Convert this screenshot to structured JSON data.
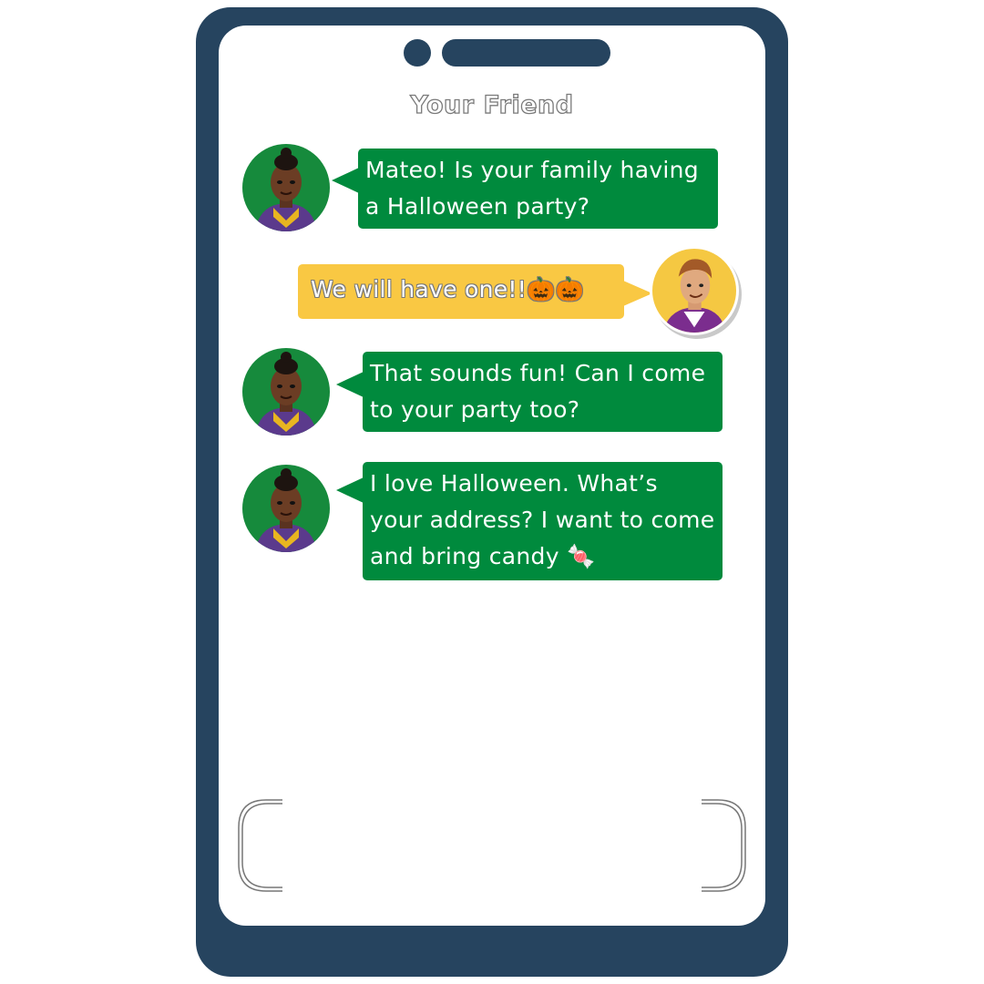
{
  "header": {
    "contact_name": "Your Friend"
  },
  "messages": [
    {
      "sender": "friend",
      "text": "Mateo! Is your family having a Halloween party?"
    },
    {
      "sender": "me",
      "text": "We will have one!!🎃🎃"
    },
    {
      "sender": "friend",
      "text": "That sounds fun! Can I come to your party too?"
    },
    {
      "sender": "friend",
      "text": "I love Halloween. What’s your address? I want to come and bring candy 🍬"
    }
  ],
  "colors": {
    "phone_frame": "#26445f",
    "friend_bubble": "#008a3d",
    "my_bubble": "#f9c843",
    "friend_avatar_bg": "#168a3c",
    "my_avatar_bg": "#f5c842"
  },
  "icons": {
    "friend_avatar": "friend-avatar",
    "my_avatar": "mateo-avatar",
    "camera": "camera-icon",
    "speaker": "speaker-icon"
  }
}
